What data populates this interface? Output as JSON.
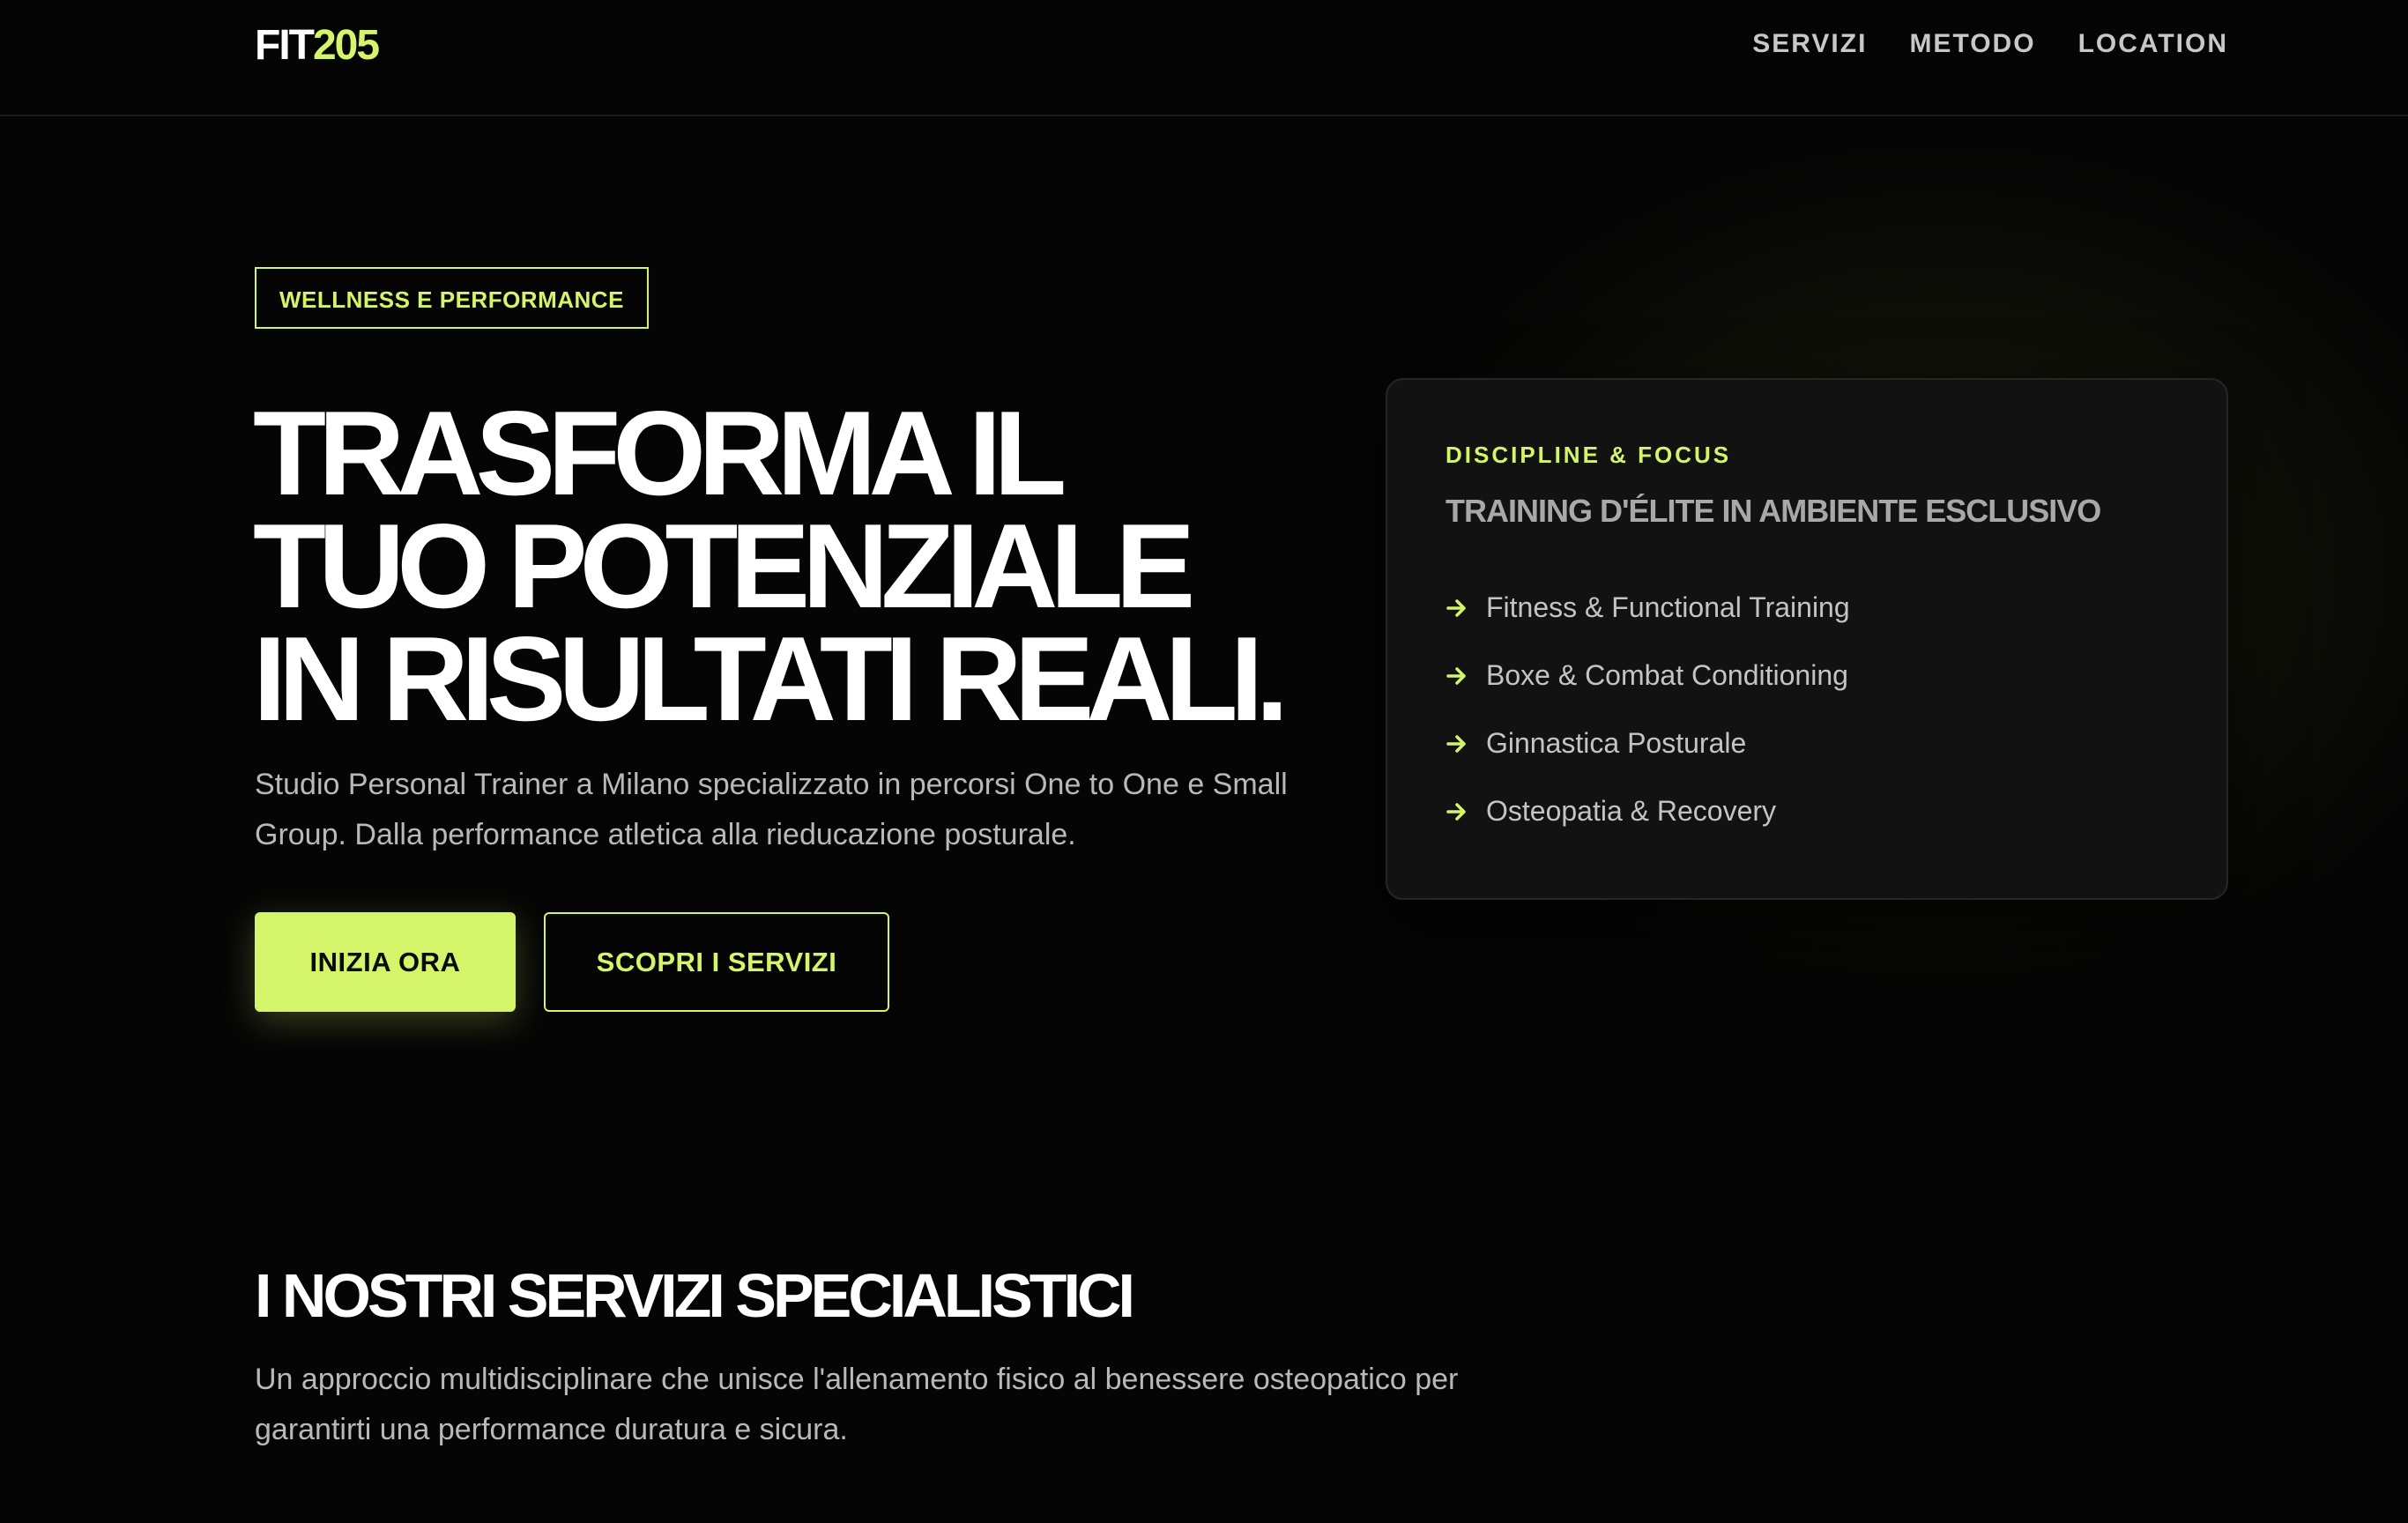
{
  "header": {
    "logo_part1": "FIT",
    "logo_part2": "205",
    "nav": [
      "SERVIZI",
      "METODO",
      "LOCATION"
    ]
  },
  "hero": {
    "badge": "WELLNESS E PERFORMANCE",
    "headline_lines": [
      "TRASFORMA IL",
      "TUO POTENZIALE",
      "IN RISULTATI REALI."
    ],
    "subtitle": "Studio Personal Trainer a Milano specializzato in percorsi One to One e Small Group. Dalla performance atletica alla rieducazione posturale.",
    "primary_button": "INIZIA ORA",
    "secondary_button": "SCOPRI I SERVIZI"
  },
  "card": {
    "eyebrow": "DISCIPLINE & FOCUS",
    "title": "TRAINING D'ÉLITE IN AMBIENTE ESCLUSIVO",
    "items": [
      "Fitness & Functional Training",
      "Boxe & Combat Conditioning",
      "Ginnastica Posturale",
      "Osteopatia & Recovery"
    ],
    "item_icon": "arrow-right-icon"
  },
  "services": {
    "title": "I NOSTRI SERVIZI SPECIALISTICI",
    "description": "Un approccio multidisciplinare che unisce l'allenamento fisico al benessere osteopatico per garantirti una performance duratura e sicura."
  },
  "colors": {
    "accent": "#d4f56a",
    "background": "#050505",
    "card_bg": "#121212"
  }
}
